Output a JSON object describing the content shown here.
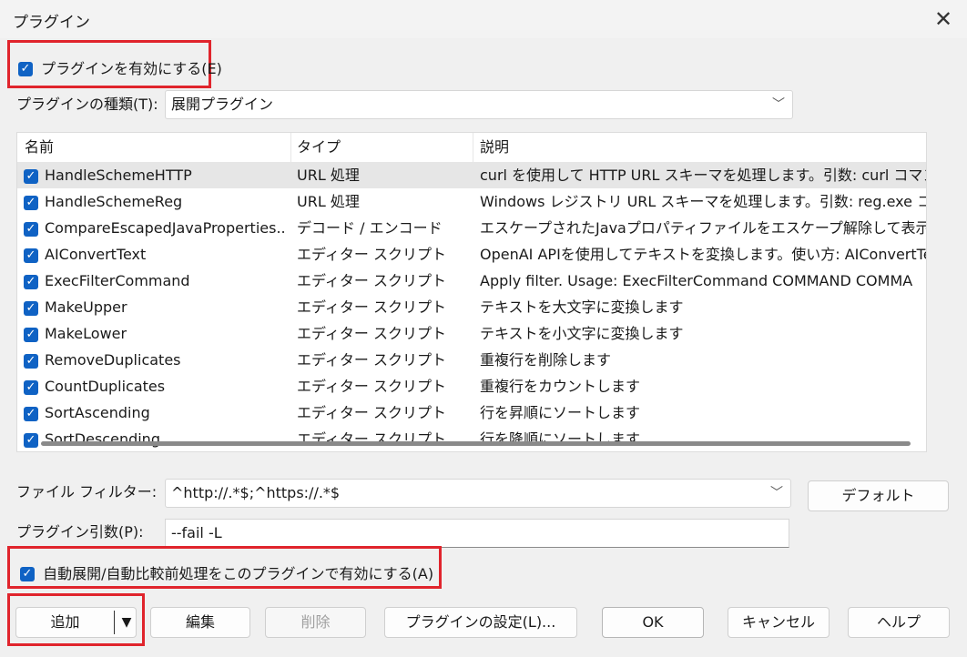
{
  "window": {
    "title": "プラグイン",
    "close_glyph": "✕"
  },
  "enable_plugins": {
    "label": "プラグインを有効にする(E)",
    "checked": true
  },
  "plugin_type": {
    "label": "プラグインの種類(T):",
    "value": "展開プラグイン"
  },
  "table": {
    "columns": [
      "名前",
      "タイプ",
      "説明"
    ],
    "rows": [
      {
        "name": "HandleSchemeHTTP",
        "type": "URL 処理",
        "desc": "curl を使用して HTTP URL スキーマを処理します。引数: curl コマンド"
      },
      {
        "name": "HandleSchemeReg",
        "type": "URL 処理",
        "desc": "Windows レジストリ URL スキーマを処理します。引数: reg.exe コマン"
      },
      {
        "name": "CompareEscapedJavaProperties...",
        "type": "デコード / エンコード",
        "desc": "エスケープされたJavaプロパティファイルをエスケープ解除して表示します。"
      },
      {
        "name": "AIConvertText",
        "type": "エディター スクリプト",
        "desc": "OpenAI APIを使用してテキストを変換します。使い方: AIConvertTex"
      },
      {
        "name": "ExecFilterCommand",
        "type": "エディター スクリプト",
        "desc": "Apply filter.  Usage: ExecFilterCommand COMMAND  COMMA"
      },
      {
        "name": "MakeUpper",
        "type": "エディター スクリプト",
        "desc": "テキストを大文字に変換します"
      },
      {
        "name": "MakeLower",
        "type": "エディター スクリプト",
        "desc": "テキストを小文字に変換します"
      },
      {
        "name": "RemoveDuplicates",
        "type": "エディター スクリプト",
        "desc": "重複行を削除します"
      },
      {
        "name": "CountDuplicates",
        "type": "エディター スクリプト",
        "desc": "重複行をカウントします"
      },
      {
        "name": "SortAscending",
        "type": "エディター スクリプト",
        "desc": "行を昇順にソートします"
      },
      {
        "name": "SortDescending",
        "type": "エディター スクリプト",
        "desc": "行を降順にソートします"
      }
    ]
  },
  "file_filter": {
    "label": "ファイル フィルター:",
    "value": "^http://.*$;^https://.*$",
    "default_button": "デフォルト"
  },
  "plugin_args": {
    "label": "プラグイン引数(P):",
    "value": "--fail -L"
  },
  "auto_unpack": {
    "label": "自動展開/自動比較前処理をこのプラグインで有効にする(A)",
    "checked": true
  },
  "buttons": {
    "add": "追加",
    "edit": "編集",
    "delete": "削除",
    "plugin_settings": "プラグインの設定(L)...",
    "ok": "OK",
    "cancel": "キャンセル",
    "help": "ヘルプ"
  },
  "colors": {
    "accent": "#0f62c4",
    "highlight_border": "#e0242c"
  }
}
